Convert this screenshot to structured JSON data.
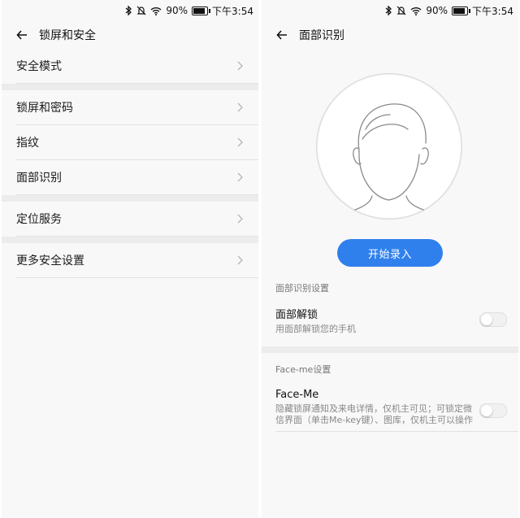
{
  "status": {
    "battery": "90%",
    "time": "下午3:54",
    "battery_level": 0.9
  },
  "left": {
    "title": "锁屏和安全",
    "groups": [
      [
        "安全模式"
      ],
      [
        "锁屏和密码",
        "指纹",
        "面部识别"
      ],
      [
        "定位服务"
      ],
      [
        "更多安全设置"
      ]
    ]
  },
  "right": {
    "title": "面部识别",
    "start_button": "开始录入",
    "section1": "面部识别设置",
    "face_unlock": {
      "title": "面部解锁",
      "desc": "用面部解锁您的手机",
      "on": false
    },
    "section2": "Face-me设置",
    "face_me": {
      "title": "Face-Me",
      "desc": "隐藏锁屏通知及来电详情，仅机主可见；可锁定微信界面（单击Me-key键）、图库，仅机主可以操作",
      "on": false
    }
  },
  "colors": {
    "accent": "#2f80ed",
    "background": "#f8f8f8",
    "separator": "#ececec"
  },
  "icons": [
    "bluetooth-icon",
    "silent-icon",
    "wifi-icon",
    "battery-icon",
    "back-arrow-icon",
    "chevron-right-icon"
  ]
}
